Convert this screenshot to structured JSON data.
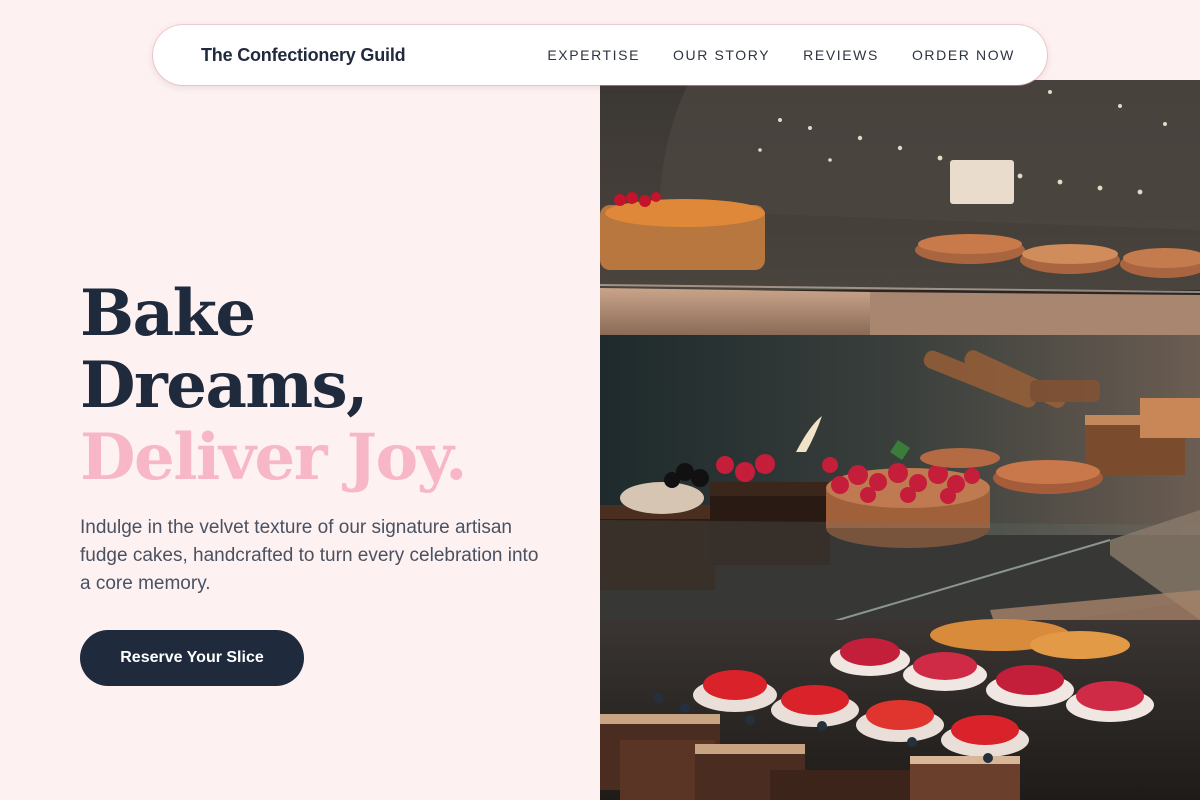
{
  "nav": {
    "brand": "The Confectionery Guild",
    "links": [
      {
        "label": "EXPERTISE"
      },
      {
        "label": "OUR STORY"
      },
      {
        "label": "REVIEWS"
      },
      {
        "label": "ORDER NOW"
      }
    ]
  },
  "hero": {
    "headline_line1": "Bake",
    "headline_line2": "Dreams,",
    "headline_accent": "Deliver Joy.",
    "description": "Indulge in the velvet texture of our signature artisan fudge cakes, handcrafted to turn every celebration into a core memory.",
    "cta_label": "Reserve Your Slice",
    "image_subject": "bakery display case with tarts and cakes"
  },
  "colors": {
    "background": "#fdf1f2",
    "navy": "#1f2a3c",
    "accent_pink": "#f7b7c7",
    "body_text": "#4a5160"
  }
}
